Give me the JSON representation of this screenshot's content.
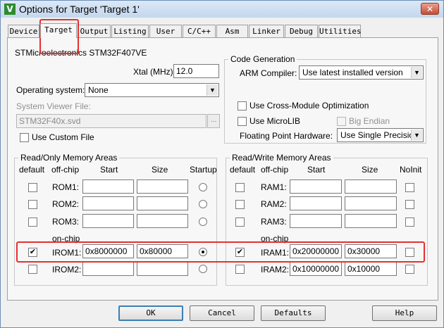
{
  "window": {
    "app_icon": "V",
    "title": "Options for Target 'Target 1'",
    "close_icon": "✕"
  },
  "tabs": [
    "Device",
    "Target",
    "Output",
    "Listing",
    "User",
    "C/C++",
    "Asm",
    "Linker",
    "Debug",
    "Utilities"
  ],
  "device_name": "STMicroelectronics STM32F407VE",
  "xtal": {
    "label": "Xtal (MHz):",
    "value": "12.0"
  },
  "os": {
    "label": "Operating system:",
    "value": "None"
  },
  "svf": {
    "label": "System Viewer File:",
    "value": "STM32F40x.svd",
    "browse": "..."
  },
  "use_custom_file": {
    "label": "Use Custom File",
    "checked": false
  },
  "codegen": {
    "title": "Code Generation",
    "compiler_label": "ARM Compiler:",
    "compiler_value": "Use latest installed version",
    "cross_module": "Use Cross-Module Optimization",
    "microlib": "Use MicroLIB",
    "big_endian": "Big Endian",
    "fpu_label": "Floating Point Hardware:",
    "fpu_value": "Use Single Precision"
  },
  "ro_memory": {
    "title": "Read/Only Memory Areas",
    "headers": {
      "default": "default",
      "offchip": "off-chip",
      "start": "Start",
      "size": "Size",
      "startup": "Startup"
    },
    "onchip_label": "on-chip",
    "rows": [
      {
        "name": "ROM1:",
        "start": "",
        "size": "",
        "default": false,
        "startup": false
      },
      {
        "name": "ROM2:",
        "start": "",
        "size": "",
        "default": false,
        "startup": false
      },
      {
        "name": "ROM3:",
        "start": "",
        "size": "",
        "default": false,
        "startup": false
      },
      {
        "name": "IROM1:",
        "start": "0x8000000",
        "size": "0x80000",
        "default": true,
        "startup": true
      },
      {
        "name": "IROM2:",
        "start": "",
        "size": "",
        "default": false,
        "startup": false
      }
    ]
  },
  "rw_memory": {
    "title": "Read/Write Memory Areas",
    "headers": {
      "default": "default",
      "offchip": "off-chip",
      "start": "Start",
      "size": "Size",
      "noinit": "NoInit"
    },
    "onchip_label": "on-chip",
    "rows": [
      {
        "name": "RAM1:",
        "start": "",
        "size": "",
        "default": false,
        "noinit": false
      },
      {
        "name": "RAM2:",
        "start": "",
        "size": "",
        "default": false,
        "noinit": false
      },
      {
        "name": "RAM3:",
        "start": "",
        "size": "",
        "default": false,
        "noinit": false
      },
      {
        "name": "IRAM1:",
        "start": "0x20000000",
        "size": "0x30000",
        "default": true,
        "noinit": false
      },
      {
        "name": "IRAM2:",
        "start": "0x10000000",
        "size": "0x10000",
        "default": false,
        "noinit": false
      }
    ]
  },
  "buttons": {
    "ok": "OK",
    "cancel": "Cancel",
    "defaults": "Defaults",
    "help": "Help"
  },
  "highlight_color": "#e53030"
}
